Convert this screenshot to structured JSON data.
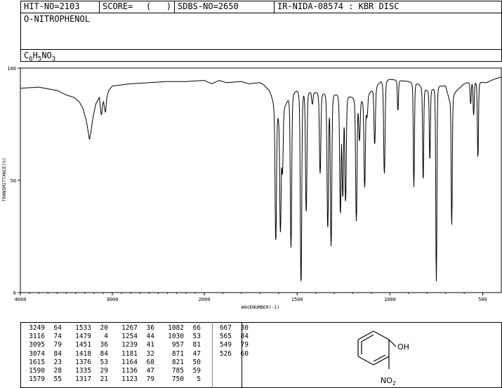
{
  "header": {
    "hit_no": "HIT-NO=2103",
    "score_label": "SCORE=",
    "score_value": "(   )",
    "sdbs_no": "SDBS-NO=2650",
    "ir_info": "IR-NIDA-08574 : KBR DISC"
  },
  "compound": {
    "name": "O-NITROPHENOL",
    "formula_c": "C",
    "formula_c_n": "6",
    "formula_h": "H",
    "formula_h_n": "5",
    "formula_rest": "NO",
    "formula_o_n": "3"
  },
  "structure": {
    "oh_label": "OH",
    "no2_label": "NO",
    "no2_sub": "2"
  },
  "chart_data": {
    "type": "line",
    "xlabel": "WAVENUMBER(-1)",
    "ylabel": "TRANSMITTANCE(%)",
    "x_reversed": true,
    "xlim": [
      4000,
      400
    ],
    "ylim": [
      0,
      100
    ],
    "x_ticks": [
      4000,
      3000,
      2000,
      1500,
      1000,
      500
    ],
    "y_ticks": [
      0,
      50,
      100
    ],
    "x_tick_labels": [
      "4000",
      "3000",
      "2000",
      "1500",
      "1000",
      "500"
    ],
    "y_tick_labels": [
      "0",
      "50",
      "100"
    ],
    "baseline": [
      [
        4000,
        91
      ],
      [
        3800,
        91.5
      ],
      [
        3600,
        90
      ],
      [
        3500,
        88
      ],
      [
        3420,
        87
      ],
      [
        3360,
        85
      ],
      [
        3320,
        82
      ],
      [
        3280,
        76
      ],
      [
        3260,
        71
      ],
      [
        3249,
        68
      ],
      [
        3235,
        71
      ],
      [
        3210,
        78
      ],
      [
        3180,
        84
      ],
      [
        3140,
        87
      ],
      [
        3125,
        80
      ],
      [
        3116,
        79
      ],
      [
        3105,
        84
      ],
      [
        3095,
        85
      ],
      [
        3085,
        82
      ],
      [
        3074,
        80
      ],
      [
        3060,
        87
      ],
      [
        3040,
        90
      ],
      [
        3000,
        92
      ],
      [
        2800,
        93
      ],
      [
        2600,
        93.5
      ],
      [
        2400,
        94
      ],
      [
        2200,
        94
      ],
      [
        2000,
        94.5
      ],
      [
        1960,
        93
      ],
      [
        1920,
        94.5
      ],
      [
        1880,
        93.5
      ],
      [
        1800,
        94
      ],
      [
        1760,
        93
      ],
      [
        1700,
        93.5
      ],
      [
        1680,
        92.5
      ],
      [
        1650,
        90
      ],
      [
        1640,
        88
      ],
      [
        1620,
        83
      ],
      [
        1600,
        80
      ],
      [
        1560,
        84
      ],
      [
        1540,
        88
      ],
      [
        1500,
        90
      ],
      [
        1380,
        89
      ],
      [
        1250,
        88
      ],
      [
        1150,
        86
      ],
      [
        1110,
        89
      ],
      [
        1050,
        94
      ],
      [
        1000,
        95
      ],
      [
        900,
        94
      ],
      [
        850,
        93
      ],
      [
        800,
        90
      ],
      [
        760,
        91
      ],
      [
        740,
        92
      ],
      [
        700,
        92
      ],
      [
        680,
        86
      ],
      [
        640,
        90
      ],
      [
        600,
        93
      ],
      [
        560,
        94
      ],
      [
        480,
        93.5
      ],
      [
        440,
        95
      ],
      [
        400,
        96
      ]
    ],
    "peaks": [
      {
        "wavenumber": 3249,
        "transmittance": 64
      },
      {
        "wavenumber": 3116,
        "transmittance": 74
      },
      {
        "wavenumber": 3095,
        "transmittance": 79
      },
      {
        "wavenumber": 3074,
        "transmittance": 84
      },
      {
        "wavenumber": 1615,
        "transmittance": 23
      },
      {
        "wavenumber": 1590,
        "transmittance": 28
      },
      {
        "wavenumber": 1579,
        "transmittance": 55
      },
      {
        "wavenumber": 1533,
        "transmittance": 20
      },
      {
        "wavenumber": 1479,
        "transmittance": 4
      },
      {
        "wavenumber": 1451,
        "transmittance": 36
      },
      {
        "wavenumber": 1418,
        "transmittance": 84
      },
      {
        "wavenumber": 1376,
        "transmittance": 53
      },
      {
        "wavenumber": 1335,
        "transmittance": 29
      },
      {
        "wavenumber": 1317,
        "transmittance": 21
      },
      {
        "wavenumber": 1267,
        "transmittance": 36
      },
      {
        "wavenumber": 1254,
        "transmittance": 44
      },
      {
        "wavenumber": 1239,
        "transmittance": 41
      },
      {
        "wavenumber": 1181,
        "transmittance": 32
      },
      {
        "wavenumber": 1164,
        "transmittance": 68
      },
      {
        "wavenumber": 1136,
        "transmittance": 47
      },
      {
        "wavenumber": 1123,
        "transmittance": 79
      },
      {
        "wavenumber": 1082,
        "transmittance": 66
      },
      {
        "wavenumber": 1030,
        "transmittance": 53
      },
      {
        "wavenumber": 957,
        "transmittance": 81
      },
      {
        "wavenumber": 871,
        "transmittance": 47
      },
      {
        "wavenumber": 821,
        "transmittance": 50
      },
      {
        "wavenumber": 785,
        "transmittance": 59
      },
      {
        "wavenumber": 750,
        "transmittance": 5
      },
      {
        "wavenumber": 667,
        "transmittance": 30
      },
      {
        "wavenumber": 565,
        "transmittance": 84
      },
      {
        "wavenumber": 549,
        "transmittance": 79
      },
      {
        "wavenumber": 526,
        "transmittance": 60
      }
    ]
  },
  "peak_table_columns": [
    [
      [
        "3249",
        "64"
      ],
      [
        "3116",
        "74"
      ],
      [
        "3095",
        "79"
      ],
      [
        "3074",
        "84"
      ],
      [
        "1615",
        "23"
      ],
      [
        "1590",
        "28"
      ],
      [
        "1579",
        "55"
      ]
    ],
    [
      [
        "1533",
        "20"
      ],
      [
        "1479",
        "4"
      ],
      [
        "1451",
        "36"
      ],
      [
        "1418",
        "84"
      ],
      [
        "1376",
        "53"
      ],
      [
        "1335",
        "29"
      ],
      [
        "1317",
        "21"
      ]
    ],
    [
      [
        "1267",
        "36"
      ],
      [
        "1254",
        "44"
      ],
      [
        "1239",
        "41"
      ],
      [
        "1181",
        "32"
      ],
      [
        "1164",
        "68"
      ],
      [
        "1136",
        "47"
      ],
      [
        "1123",
        "79"
      ]
    ],
    [
      [
        "1082",
        "66"
      ],
      [
        "1030",
        "53"
      ],
      [
        "957",
        "81"
      ],
      [
        "871",
        "47"
      ],
      [
        "821",
        "50"
      ],
      [
        "785",
        "59"
      ],
      [
        "750",
        "5"
      ]
    ],
    [
      [
        "667",
        "30"
      ],
      [
        "565",
        "84"
      ],
      [
        "549",
        "79"
      ],
      [
        "526",
        "60"
      ]
    ]
  ]
}
